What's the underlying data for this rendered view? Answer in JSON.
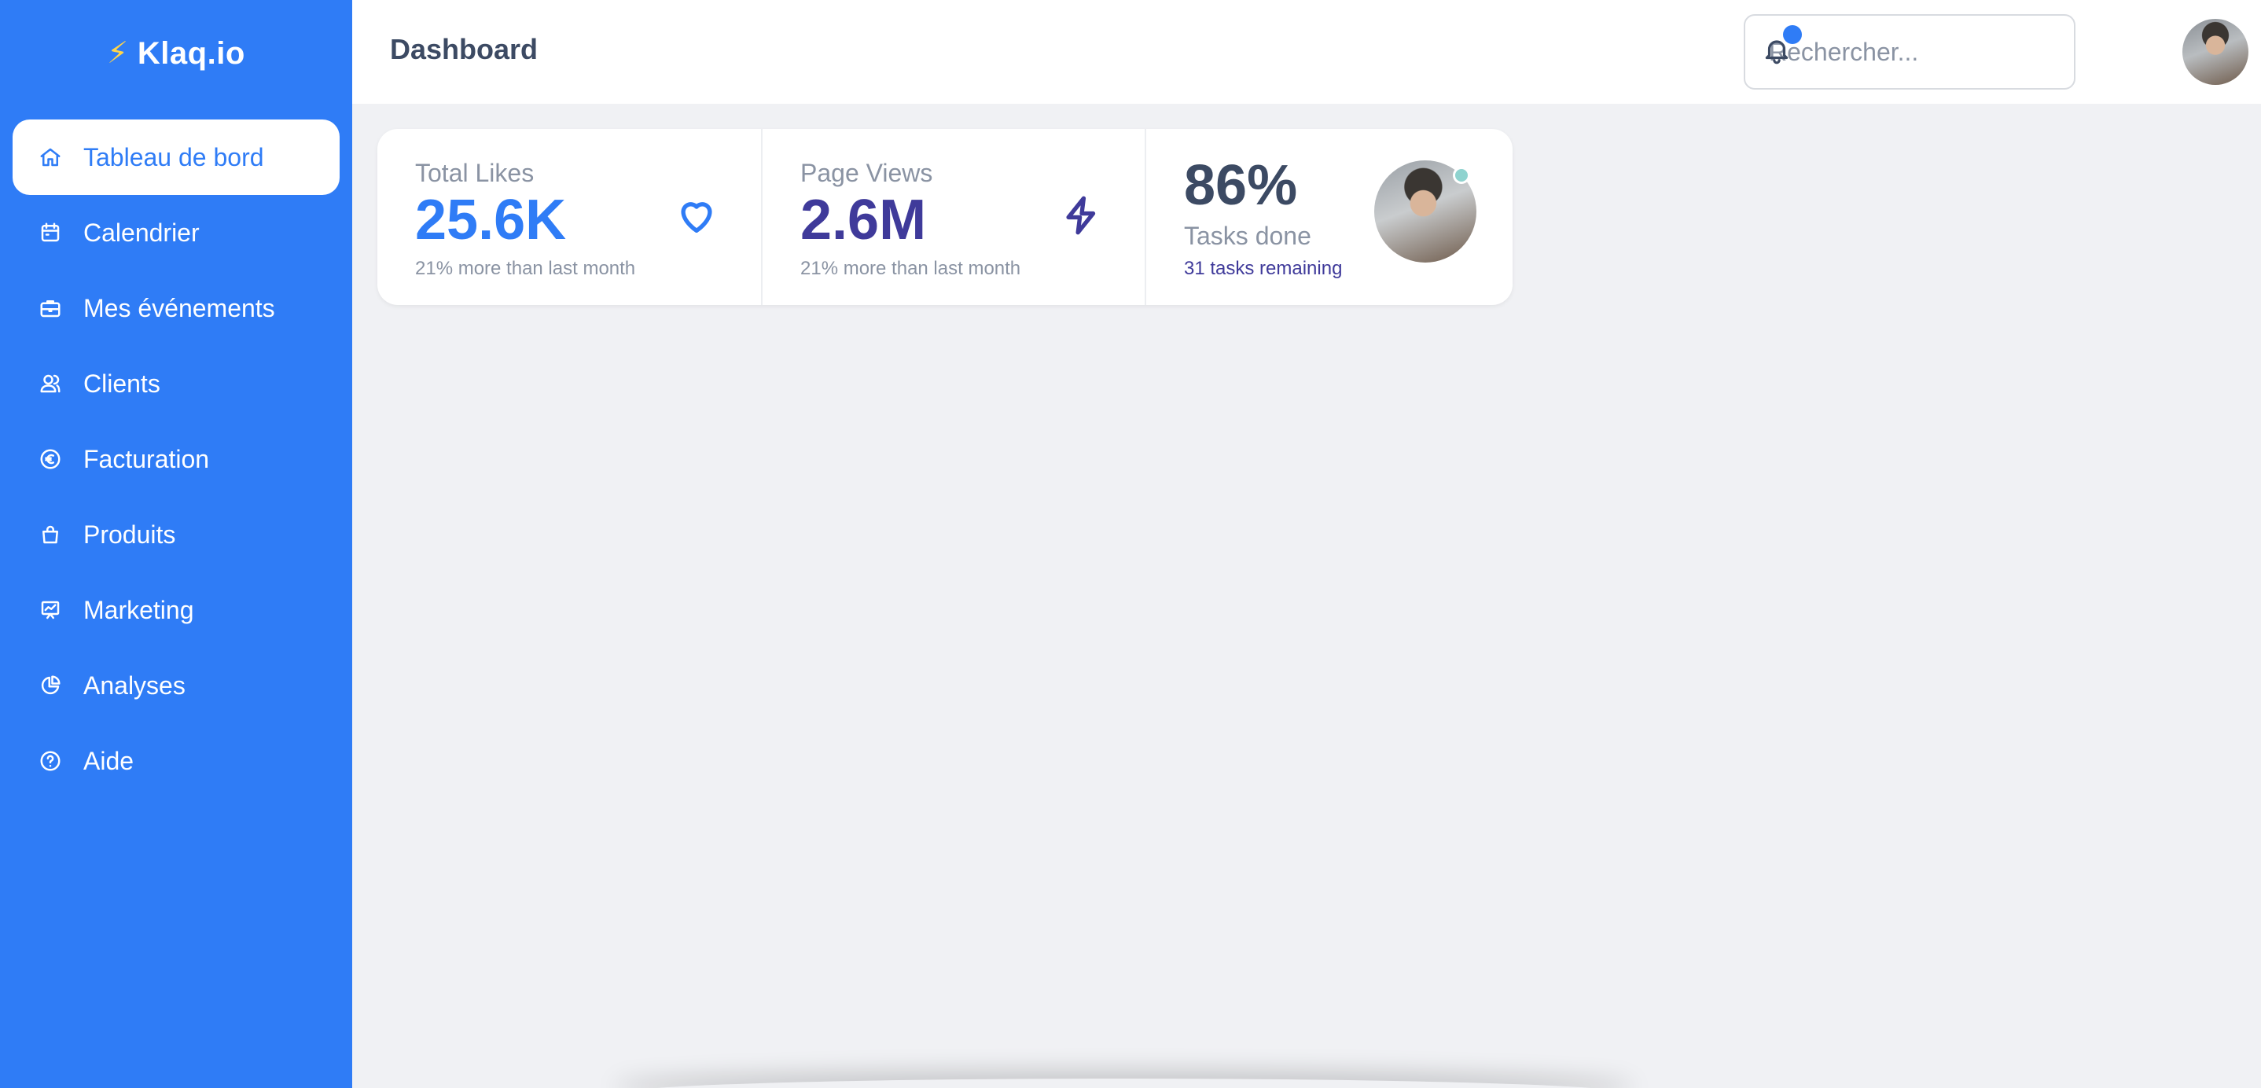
{
  "brand": {
    "icon": "⚡",
    "name": "Klaq.io"
  },
  "sidebar": {
    "items": [
      {
        "label": "Tableau de bord",
        "icon": "home-icon",
        "active": true
      },
      {
        "label": "Calendrier",
        "icon": "calendar-icon"
      },
      {
        "label": "Mes événements",
        "icon": "briefcase-icon"
      },
      {
        "label": "Clients",
        "icon": "users-icon"
      },
      {
        "label": "Facturation",
        "icon": "euro-icon"
      },
      {
        "label": "Produits",
        "icon": "shopping-bag-icon"
      },
      {
        "label": "Marketing",
        "icon": "presentation-chart-icon"
      },
      {
        "label": "Analyses",
        "icon": "pie-chart-icon"
      },
      {
        "label": "Aide",
        "icon": "help-icon"
      }
    ]
  },
  "header": {
    "title": "Dashboard",
    "search_placeholder": "Rechercher...",
    "notification_icon": "bell-icon"
  },
  "stats": {
    "likes": {
      "title": "Total Likes",
      "value": "25.6K",
      "desc": "21% more than last month",
      "icon": "heart-icon"
    },
    "views": {
      "title": "Page Views",
      "value": "2.6M",
      "desc": "21% more than last month",
      "icon": "bolt-icon"
    },
    "tasks": {
      "value": "86%",
      "label": "Tasks done",
      "remaining": "31 tasks remaining"
    }
  },
  "colors": {
    "primary": "#2f7cf6",
    "indigo": "#3f3a9a",
    "slate": "#3c4a63",
    "muted": "#8a93a3",
    "background": "#f0f1f4"
  }
}
